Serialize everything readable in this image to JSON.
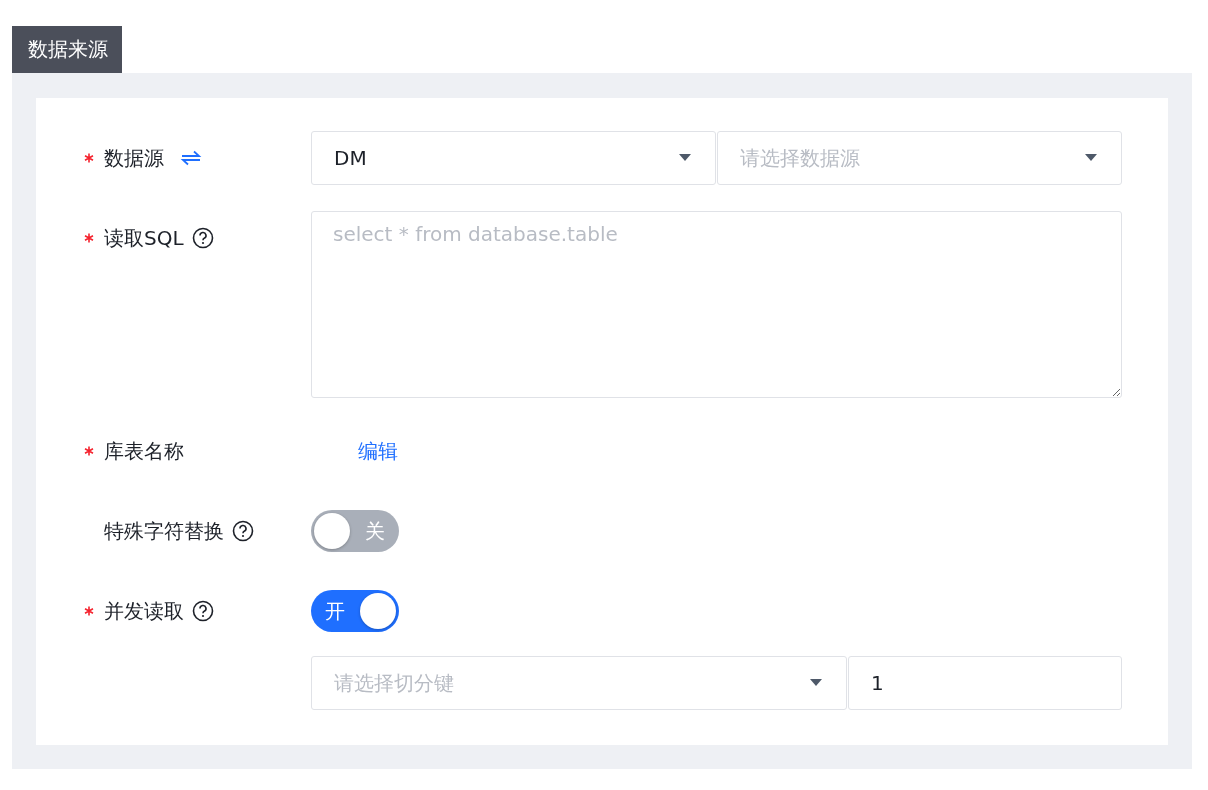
{
  "section_title": "数据来源",
  "fields": [
    {
      "kind": "select_pair",
      "label": "数据源",
      "required": true,
      "swap": true,
      "selects": [
        {
          "value": "DM"
        },
        {
          "placeholder": "请选择数据源"
        }
      ]
    },
    {
      "kind": "textarea",
      "label": "读取SQL",
      "required": true,
      "help": true,
      "placeholder": "select * from database.table"
    },
    {
      "kind": "link",
      "label": "库表名称",
      "required": true,
      "link": "编辑"
    },
    {
      "kind": "switch",
      "label": "特殊字符替换",
      "required": false,
      "help": true,
      "on": false,
      "text": "关"
    },
    {
      "kind": "switch",
      "label": "并发读取",
      "required": true,
      "help": true,
      "on": true,
      "text": "开"
    },
    {
      "kind": "select_input",
      "select_placeholder": "请选择切分键",
      "input_value": "1"
    }
  ]
}
